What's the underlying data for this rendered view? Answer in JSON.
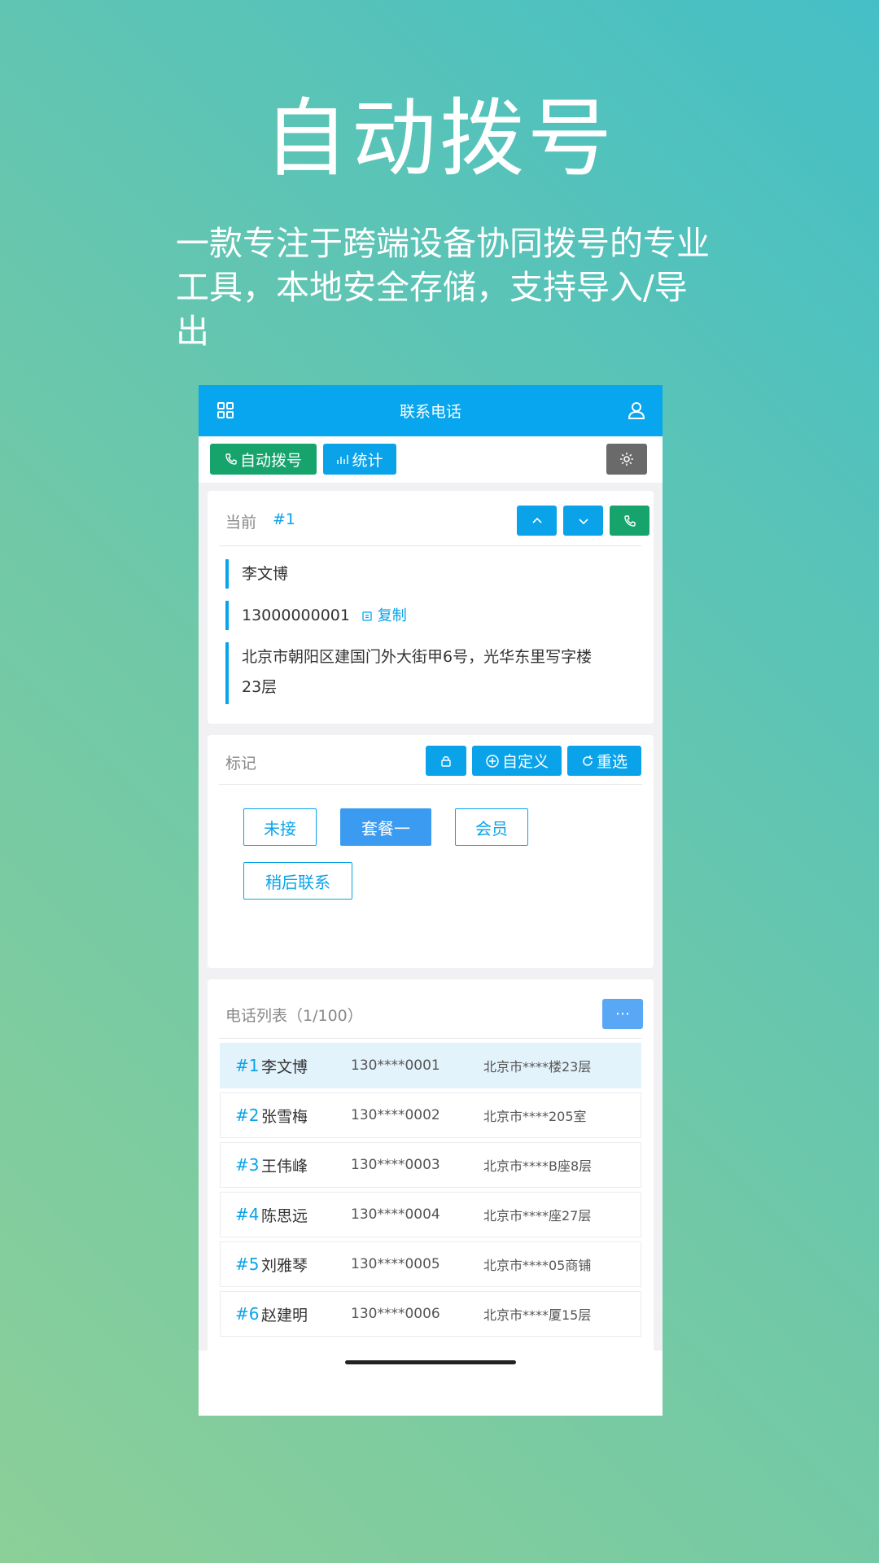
{
  "promo": {
    "headline": "自动拨号",
    "subline": "一款专注于跨端设备协同拨号的专业工具，本地安全存储，支持导入/导出"
  },
  "app": {
    "title": "联系电话",
    "toolbar": {
      "auto_dial_label": "自动拨号",
      "stats_label": "统计"
    },
    "current": {
      "label": "当前",
      "index": "#1",
      "name": "李文博",
      "phone": "13000000001",
      "copy_label": "复制",
      "address": "北京市朝阳区建国门外大街甲6号，光华东里写字楼23层"
    },
    "marks": {
      "label": "标记",
      "custom_label": "自定义",
      "reselect_label": "重选",
      "tags": [
        "未接",
        "套餐一",
        "会员",
        "稍后联系"
      ],
      "selected_tag": "套餐一"
    },
    "list": {
      "title": "电话列表（1/100）",
      "more_label": "···",
      "rows": [
        {
          "index": "#1",
          "name": "李文博",
          "phone": "130****0001",
          "address": "北京市****楼23层"
        },
        {
          "index": "#2",
          "name": "张雪梅",
          "phone": "130****0002",
          "address": "北京市****205室"
        },
        {
          "index": "#3",
          "name": "王伟峰",
          "phone": "130****0003",
          "address": "北京市****B座8层"
        },
        {
          "index": "#4",
          "name": "陈思远",
          "phone": "130****0004",
          "address": "北京市****座27层"
        },
        {
          "index": "#5",
          "name": "刘雅琴",
          "phone": "130****0005",
          "address": "北京市****05商铺"
        },
        {
          "index": "#6",
          "name": "赵建明",
          "phone": "130****0006",
          "address": "北京市****厦15层"
        }
      ]
    },
    "icons": [
      "grid-icon",
      "user-icon",
      "phone-icon",
      "chart-icon",
      "gear-icon",
      "chevron-up-icon",
      "chevron-down-icon",
      "copy-icon",
      "lock-icon",
      "plus-circle-icon",
      "refresh-icon"
    ],
    "colors": {
      "primary": "#0aa3ea",
      "green": "#16a46c",
      "gray_button": "#6a6a6a",
      "selected_tag": "#3b9bf0"
    }
  }
}
